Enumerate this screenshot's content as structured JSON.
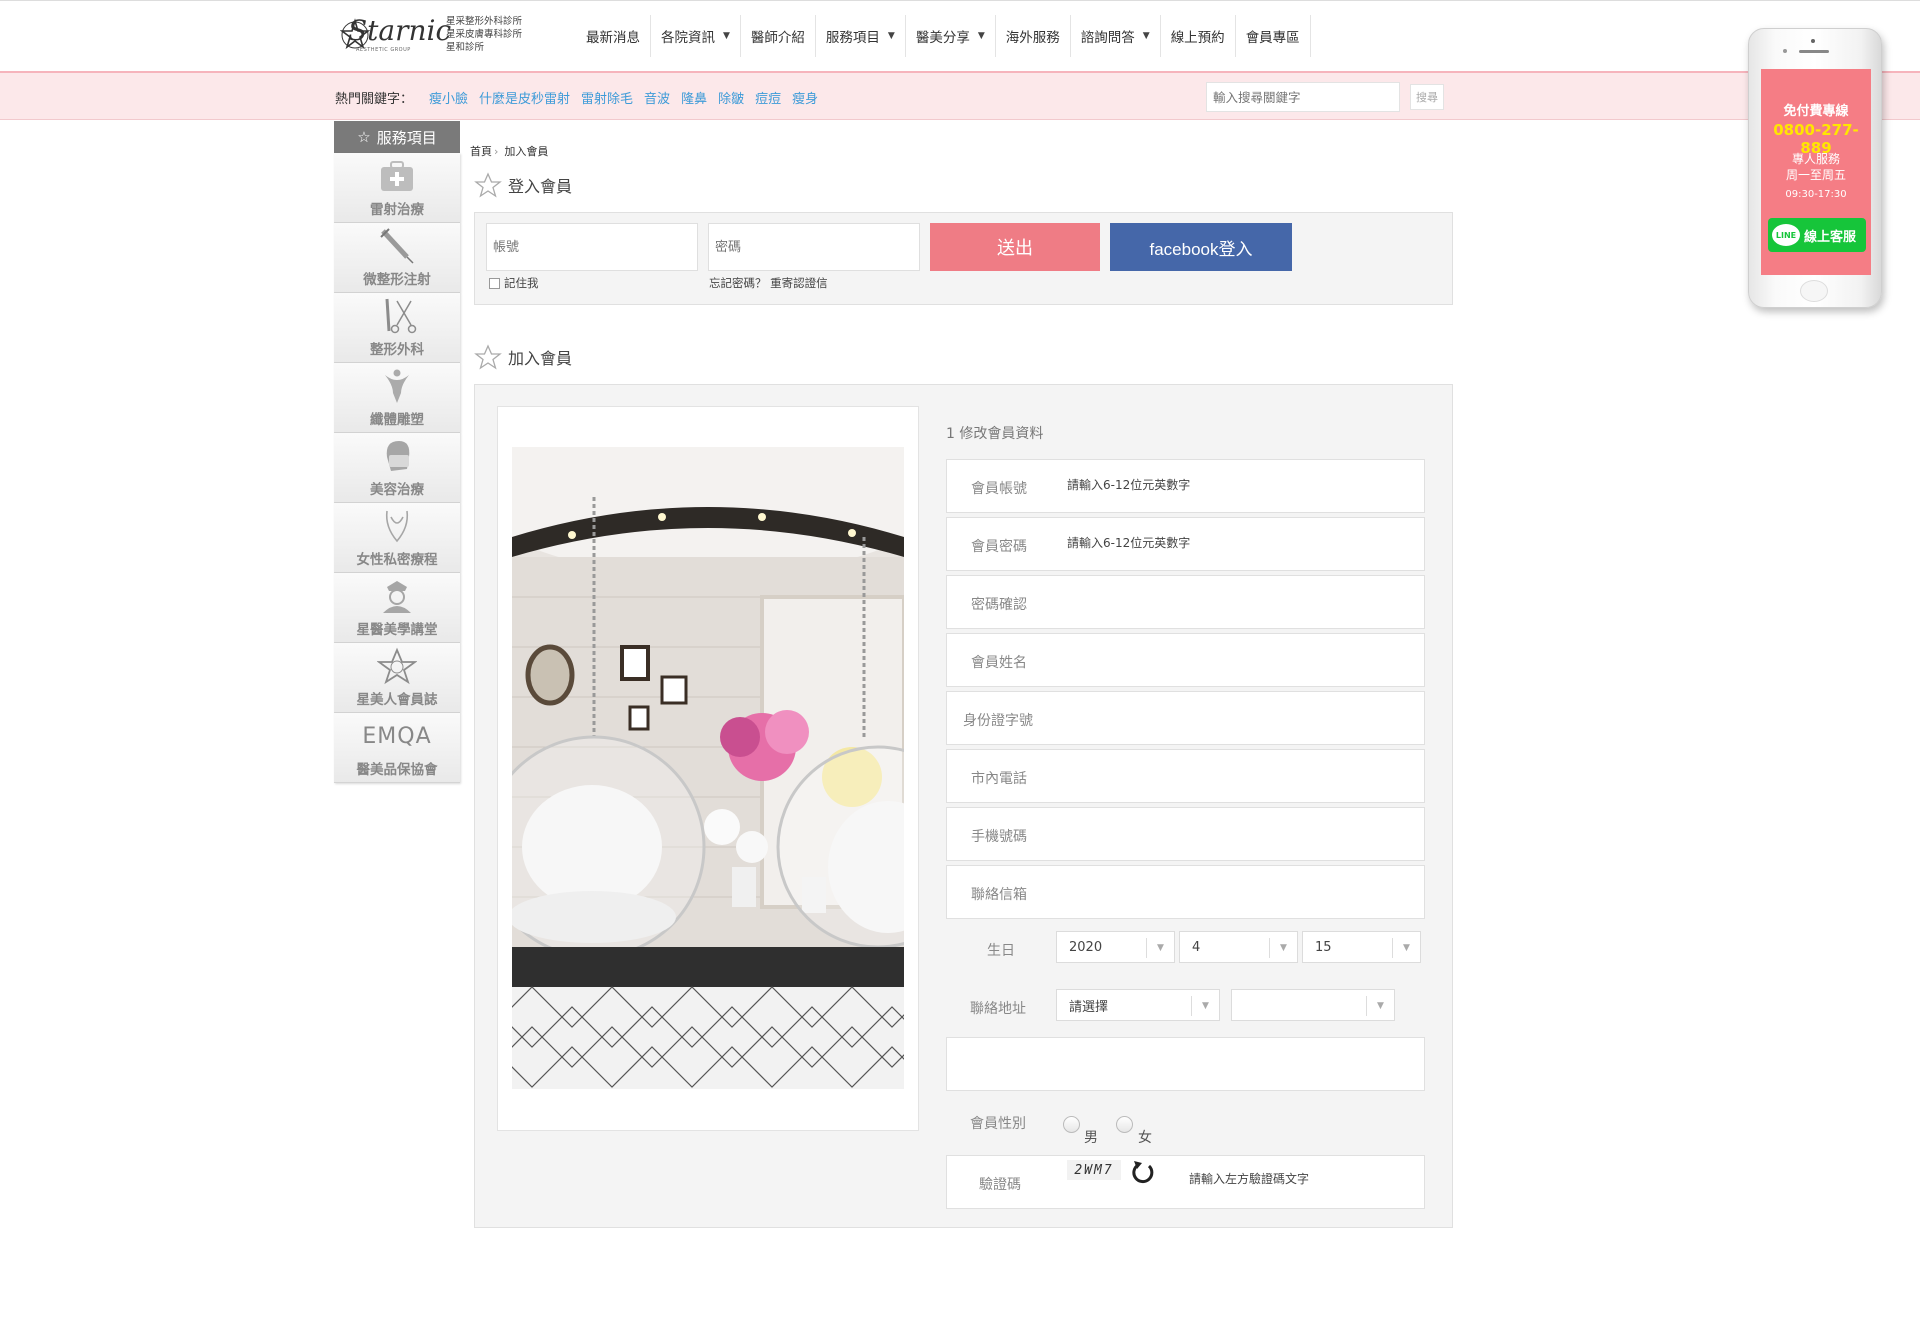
{
  "logo": {
    "mark": "Starnic",
    "sub": "AESTHETIC GROUP",
    "lines": [
      "星采整形外科診所",
      "星采皮膚專科診所",
      "星和診所"
    ]
  },
  "nav": [
    {
      "label": "最新消息",
      "caret": false
    },
    {
      "label": "各院資訊",
      "caret": true
    },
    {
      "label": "醫師介紹",
      "caret": false
    },
    {
      "label": "服務項目",
      "caret": true
    },
    {
      "label": "醫美分享",
      "caret": true
    },
    {
      "label": "海外服務",
      "caret": false
    },
    {
      "label": "諮詢問答",
      "caret": true
    },
    {
      "label": "線上預約",
      "caret": false
    },
    {
      "label": "會員專區",
      "caret": false
    }
  ],
  "hotbar": {
    "label": "熱門關鍵字：",
    "keywords": [
      "瘦小臉",
      "什麼是皮秒雷射",
      "雷射除毛",
      "音波",
      "隆鼻",
      "除皺",
      "痘痘",
      "瘦身"
    ],
    "search_placeholder": "輸入搜尋關鍵字",
    "search_button": "搜尋"
  },
  "sidebar": {
    "title": "服務項目",
    "items": [
      {
        "label": "雷射治療",
        "icon": "first-aid-kit-icon"
      },
      {
        "label": "微整形注射",
        "icon": "syringe-icon"
      },
      {
        "label": "整形外科",
        "icon": "scissors-scalpel-icon"
      },
      {
        "label": "纖體雕塑",
        "icon": "body-figure-icon"
      },
      {
        "label": "美容治療",
        "icon": "face-mask-icon"
      },
      {
        "label": "女性私密療程",
        "icon": "female-body-icon"
      },
      {
        "label": "星醫美學講堂",
        "icon": "nurse-icon"
      },
      {
        "label": "星美人會員誌",
        "icon": "star-emblem-icon"
      },
      {
        "label": "醫美品保協會",
        "icon": "emqa-logo",
        "logo_text": "EMQA"
      }
    ]
  },
  "breadcrumb": {
    "home": "首頁",
    "current": "加入會員"
  },
  "login": {
    "title": "登入會員",
    "account_placeholder": "帳號",
    "password_placeholder": "密碼",
    "submit": "送出",
    "facebook": "facebook登入",
    "remember": "記住我",
    "forgot": "忘記密碼？ 重寄認證信"
  },
  "join": {
    "title": "加入會員",
    "form_title": "1 修改會員資料",
    "fields": {
      "account": {
        "label": "會員帳號",
        "hint": "請輸入6-12位元英數字"
      },
      "password": {
        "label": "會員密碼",
        "hint": "請輸入6-12位元英數字"
      },
      "confirm": {
        "label": "密碼確認"
      },
      "name": {
        "label": "會員姓名"
      },
      "id_number": {
        "label": "身份證字號"
      },
      "phone": {
        "label": "市內電話"
      },
      "mobile": {
        "label": "手機號碼"
      },
      "email": {
        "label": "聯絡信箱"
      }
    },
    "birthday": {
      "label": "生日",
      "year": "2020",
      "month": "4",
      "day": "15"
    },
    "address": {
      "label": "聯絡地址",
      "city": "請選擇",
      "district": ""
    },
    "gender": {
      "label": "會員性別",
      "male": "男",
      "female": "女"
    },
    "captcha": {
      "label": "驗證碼",
      "code": "2WM7",
      "hint": "請輸入左方驗證碼文字"
    }
  },
  "phone_widget": {
    "title": "免付費專線",
    "number": "0800-277-889",
    "service_line1": "專人服務",
    "service_line2": "周一至周五",
    "hours": "09:30-17:30",
    "line_logo": "LINE",
    "line_label": "線上客服"
  },
  "colors": {
    "accent_pink": "#f57d85",
    "submit_pink": "#ef7c85",
    "facebook_blue": "#4567a9",
    "keyword_blue": "#3e9bd8",
    "line_green": "#16c53a",
    "hotline_yellow": "#ffe600"
  }
}
